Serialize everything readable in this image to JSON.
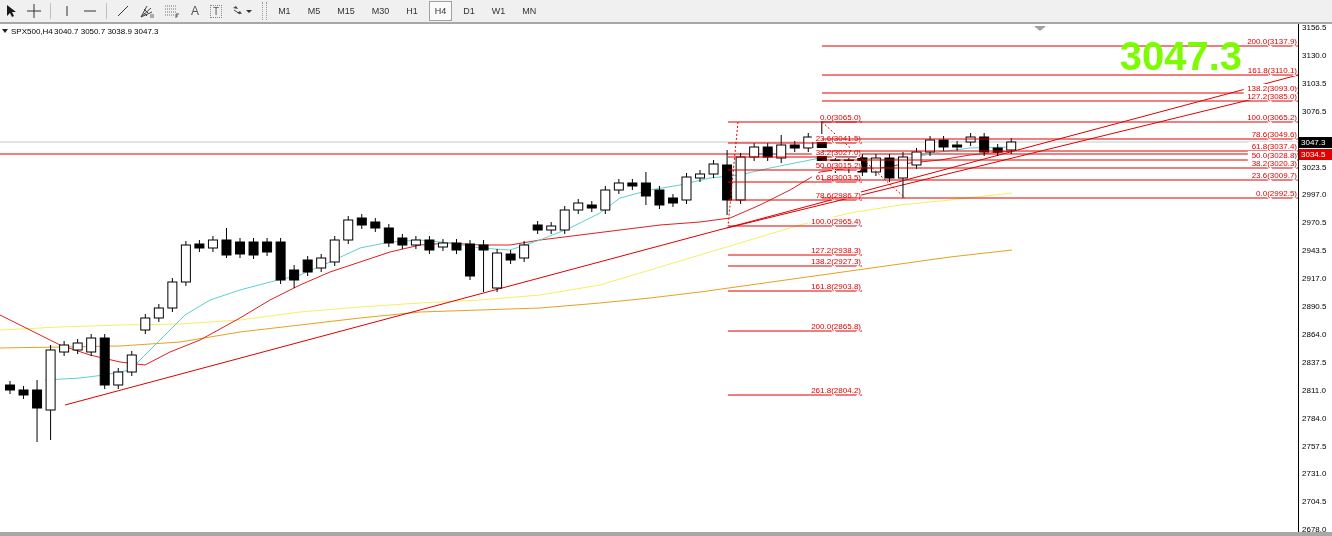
{
  "toolbar": {
    "tools": [
      {
        "kind": "cursor"
      },
      {
        "kind": "crosshair"
      },
      {
        "kind": "vline"
      },
      {
        "kind": "hline"
      },
      {
        "kind": "trendline"
      },
      {
        "kind": "fibfan"
      },
      {
        "kind": "fibgrid"
      },
      {
        "kind": "text",
        "label": "A"
      },
      {
        "kind": "label",
        "label": "T"
      },
      {
        "kind": "shapes"
      }
    ],
    "timeframes": [
      {
        "label": "M1",
        "selected": false
      },
      {
        "label": "M5",
        "selected": false
      },
      {
        "label": "M15",
        "selected": false
      },
      {
        "label": "M30",
        "selected": false
      },
      {
        "label": "H1",
        "selected": false
      },
      {
        "label": "H4",
        "selected": true
      },
      {
        "label": "D1",
        "selected": false
      },
      {
        "label": "W1",
        "selected": false
      },
      {
        "label": "MN",
        "selected": false
      }
    ]
  },
  "chart": {
    "symbol": "SPX500,H4",
    "ohlc": "3040.7 3050.7 3038.9 3047.3",
    "big_price": "3047.3",
    "fib_left": [
      "0.0(3065.0)",
      "23.6(3041.5)",
      "38.2(3027.0)",
      "50.0(3015.2)",
      "61.8(3003.5)",
      "78.6(2986.7)",
      "100.0(2965.4)",
      "127.2(2938.3)",
      "138.2(2927.3)",
      "161.8(2903.8)",
      "200.0(2865.8)",
      "261.8(2804.2)"
    ],
    "fib_right": [
      "200.0(3137.9)",
      "161.8(3110.1)",
      "138.2(3093.0)",
      "127.2(3085.0)",
      "100.0(3065.2)",
      "78.6(3049.6)",
      "61.8(3037.4)",
      "50.0(3028.8)",
      "38.2(3020.3)",
      "23.6(3009.7)",
      "0.0(2992.5)"
    ],
    "price_axis": {
      "ticks": [
        "3156.5",
        "3130.0",
        "3103.5",
        "3076.5",
        "3023.5",
        "2997.0",
        "2970.5",
        "2943.5",
        "2917.0",
        "2890.5",
        "2864.0",
        "2837.5",
        "2811.0",
        "2784.0",
        "2757.5",
        "2731.0",
        "2704.5",
        "2678.0"
      ],
      "bid_label": "3047.3",
      "line_label": "3034.5"
    }
  }
}
